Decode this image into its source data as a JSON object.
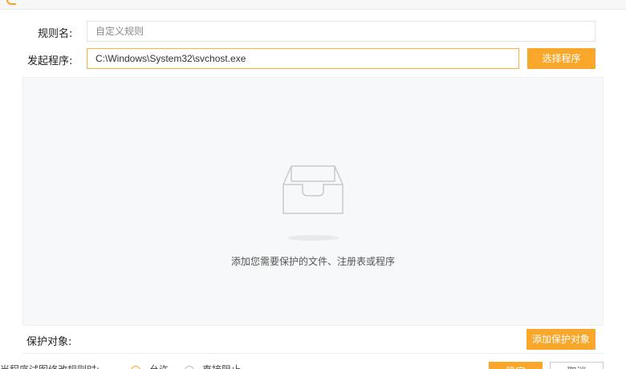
{
  "form": {
    "rule_name_label": "规则名:",
    "rule_name_placeholder": "自定义规则",
    "launcher_label": "发起程序:",
    "launcher_value": "C:\\Windows\\System32\\svchost.exe",
    "select_program_button": "选择程序"
  },
  "panel": {
    "empty_icon": "empty-inbox-icon",
    "empty_text": "添加您需要保护的文件、注册表或程序"
  },
  "protect": {
    "label": "保护对象:",
    "add_button": "添加保护对象"
  },
  "footer": {
    "policy_label": "当程序试图修改规则时:",
    "option_allow": "允许",
    "option_block": "直接阻止",
    "confirm_button": "确定",
    "cancel_button": "取消"
  },
  "colors": {
    "accent": "#f9a72b",
    "panel_bg": "#f7f8f9"
  }
}
